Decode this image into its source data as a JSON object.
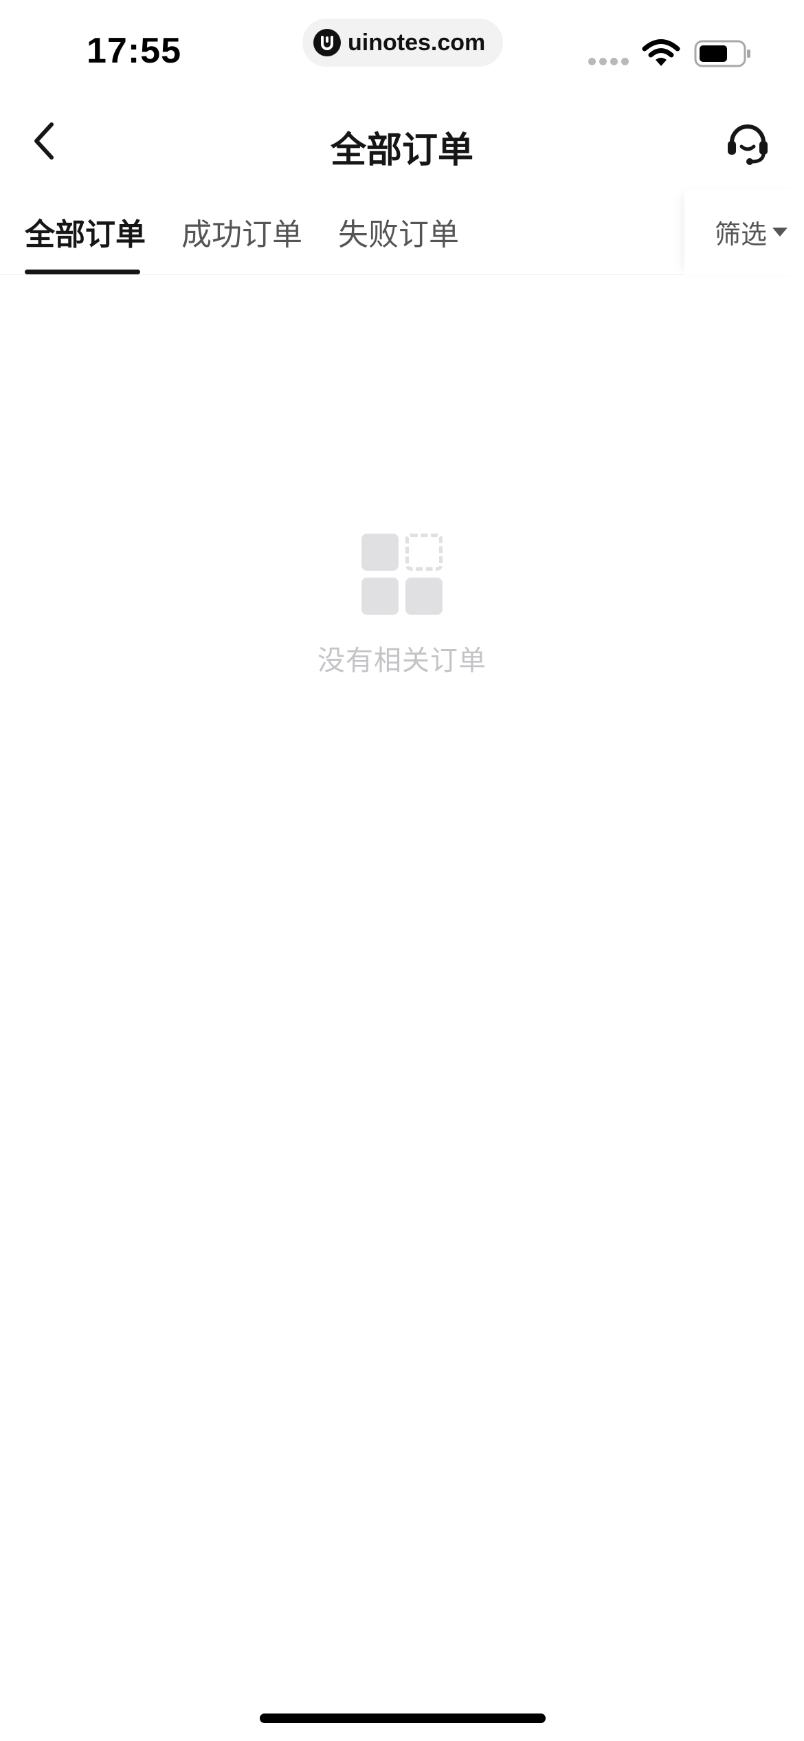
{
  "status_bar": {
    "time": "17:55",
    "url": "uinotes.com",
    "logo_icon": "uinotes-logo-icon",
    "wifi_icon": "wifi-icon",
    "battery_icon": "battery-icon"
  },
  "nav": {
    "title": "全部订单",
    "back_icon": "chevron-left-icon",
    "service_icon": "headset-icon"
  },
  "tabs": {
    "items": [
      {
        "label": "全部订单",
        "active": true
      },
      {
        "label": "成功订单",
        "active": false
      },
      {
        "label": "失败订单",
        "active": false
      }
    ],
    "filter_label": "筛选",
    "filter_icon": "caret-down-icon"
  },
  "empty_state": {
    "icon": "grid-placeholder-icon",
    "message": "没有相关订单"
  },
  "colors": {
    "text_primary": "#161616",
    "text_secondary": "#555555",
    "empty_text": "#c4c4c8",
    "empty_icon": "#e0e0e3",
    "background": "#ffffff"
  }
}
